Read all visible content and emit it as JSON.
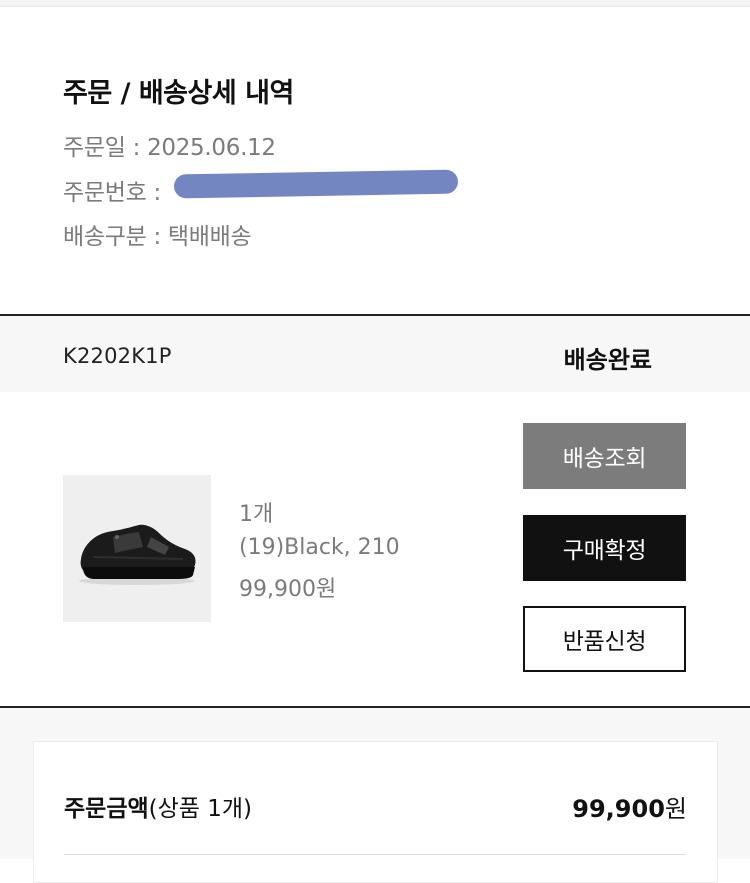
{
  "order": {
    "title": "주문 / 배송상세 내역",
    "date_label": "주문일 : ",
    "date_value": "2025.06.12",
    "number_label": "주문번호 : ",
    "delivery_type_label": "배송구분 : ",
    "delivery_type_value": "택배배송"
  },
  "shipment": {
    "code": "K2202K1P",
    "status": "배송완료"
  },
  "item": {
    "quantity": "1개",
    "option": "(19)Black, 210",
    "price": "99,900원",
    "image_icon": "shoe-icon"
  },
  "actions": {
    "track": "배송조회",
    "confirm": "구매확정",
    "return": "반품신청"
  },
  "summary": {
    "label_bold": "주문금액",
    "label_detail": "(상품 1개)",
    "amount": "99,900",
    "currency": "원"
  },
  "colors": {
    "redaction": "#6d7fbf",
    "track_button": "#7c7c7c",
    "confirm_button": "#111111"
  }
}
